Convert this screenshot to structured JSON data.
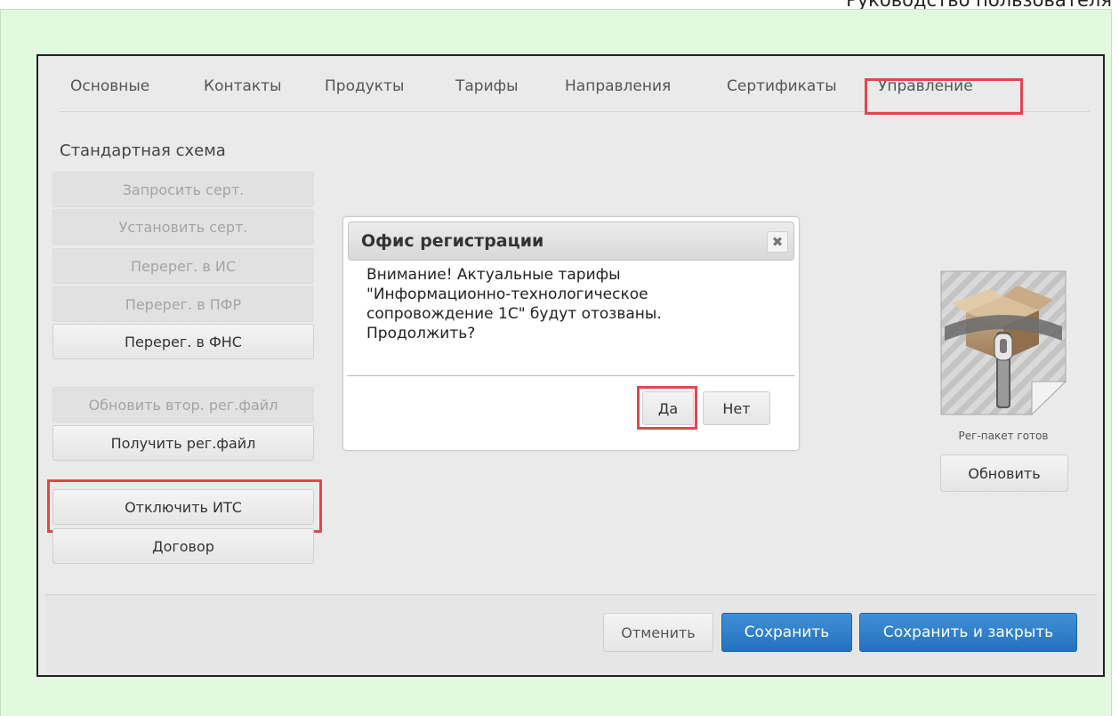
{
  "document_header": "Руководство пользователя",
  "tabs": [
    {
      "label": "Основные"
    },
    {
      "label": "Контакты"
    },
    {
      "label": "Продукты"
    },
    {
      "label": "Тарифы"
    },
    {
      "label": "Направления"
    },
    {
      "label": "Сертификаты"
    },
    {
      "label": "Управление"
    }
  ],
  "left_panel": {
    "section_title": "Стандартная схема",
    "buttons": [
      {
        "label": "Запросить серт."
      },
      {
        "label": "Установить серт."
      },
      {
        "label": "Перерег. в ИС"
      },
      {
        "label": "Перерег. в ПФР"
      },
      {
        "label": "Перерег. в ФНС"
      },
      {
        "label": "Обновить втор. рег.файл"
      },
      {
        "label": "Получить рег.файл"
      },
      {
        "label": "Отключить ИТС"
      },
      {
        "label": "Договор"
      }
    ]
  },
  "dialog": {
    "title": "Офис регистрации",
    "message_lines": [
      "Внимание! Актуальные тарифы",
      "\"Информационно-технологическое",
      "сопровождение 1С\" будут отозваны.",
      "Продолжить?"
    ],
    "yes_label": "Да",
    "no_label": "Нет",
    "close_glyph": "✖"
  },
  "package": {
    "status": "Рег-пакет готов",
    "refresh_label": "Обновить"
  },
  "footer": {
    "cancel_label": "Отменить",
    "save_label": "Сохранить",
    "save_close_label": "Сохранить и закрыть"
  },
  "colors": {
    "highlight": "#e0474c",
    "primary": "#2d7fcc",
    "outer_background": "#e2f8df"
  }
}
